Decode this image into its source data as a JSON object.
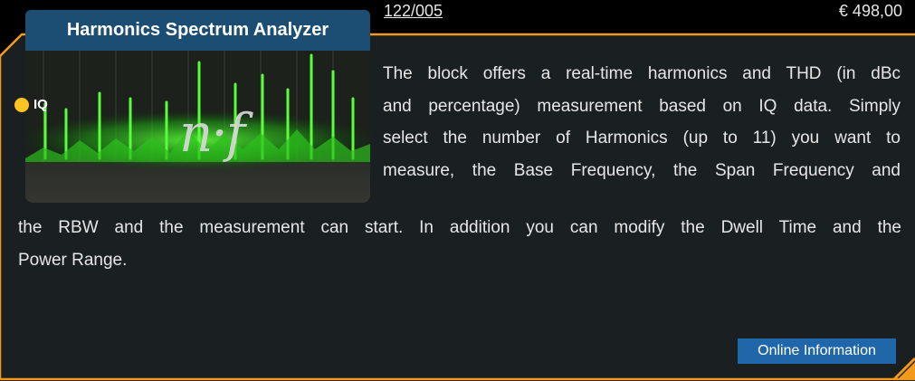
{
  "product": {
    "article_number": "122/005",
    "price": "€ 498,00",
    "title": "Harmonics Spectrum Analyzer",
    "logo_text": "n·f",
    "port": {
      "label": "IQ",
      "color": "#ffc423"
    },
    "description_top_lines": [
      "The block offers a real-time harmonics and THD (in dBc",
      "and percentage) measurement based on IQ data. Simply",
      "select the number of Harmonics (up to 11) you want to",
      "measure, the Base Frequency, the Span Frequency and"
    ],
    "description_bottom_lines": [
      "the RBW and the measurement can start. In addition you can modify the Dwell Time and the",
      "Power Range."
    ],
    "info_button_label": "Online Information"
  },
  "colors": {
    "frame": "#1a2022",
    "accent_orange": "#f39a1d",
    "title_bar": "#1c4e73",
    "button": "#1f67a8",
    "spectrum_green": "#39ff2a"
  }
}
